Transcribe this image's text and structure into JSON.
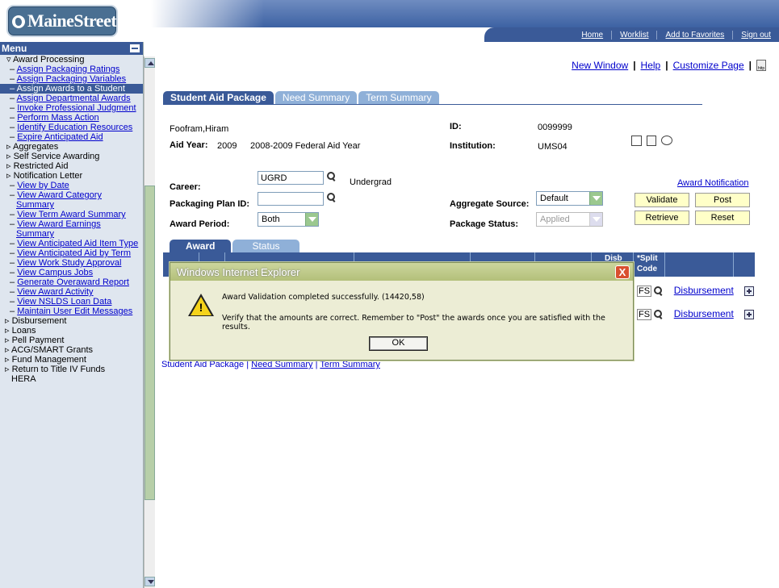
{
  "header": {
    "logo_text": "MaineStreet",
    "nav": [
      "Home",
      "Worklist",
      "Add to Favorites",
      "Sign out"
    ]
  },
  "menu": {
    "title": "Menu",
    "section": "Award Processing",
    "items": [
      {
        "label": "Assign Packaging Ratings"
      },
      {
        "label": "Assign Packaging Variables"
      },
      {
        "label": "Assign Awards to a Student",
        "selected": true
      },
      {
        "label": "Assign Departmental Awards"
      },
      {
        "label": "Invoke Professional Judgment"
      },
      {
        "label": "Perform Mass Action"
      },
      {
        "label": "Identify Education Resources"
      },
      {
        "label": "Expire Anticipated Aid"
      }
    ],
    "subsections": [
      "Aggregates",
      "Self Service Awarding",
      "Restricted Aid",
      "Notification Letter"
    ],
    "inquiry_items": [
      "View by Date",
      "View Award Category Summary",
      "View Term Award Summary",
      "View Award Earnings Summary",
      "View Anticipated Aid Item Type",
      "View Anticipated Aid by Term",
      "View Work Study Approval",
      "View Campus Jobs",
      "Generate Overaward Report",
      "View Award Activity",
      "View NSLDS Loan Data",
      "Maintain User Edit Messages"
    ],
    "top_sections": [
      "Disbursement",
      "Loans",
      "Pell Payment",
      "ACG/SMART Grants",
      "Fund Management",
      "Return to Title IV Funds",
      "HERA"
    ]
  },
  "toplinks": {
    "new_window": "New Window",
    "help": "Help",
    "customize": "Customize Page",
    "http_icon": "http"
  },
  "tabs": [
    "Student Aid Package",
    "Need Summary",
    "Term Summary"
  ],
  "student": {
    "name": "Foofram,Hiram",
    "id_label": "ID:",
    "id": "0099999",
    "aid_year_label": "Aid Year:",
    "aid_year": "2009",
    "aid_year_desc": "2008-2009 Federal Aid Year",
    "institution_label": "Institution:",
    "institution": "UMS04"
  },
  "form": {
    "career_label": "Career:",
    "career": "UGRD",
    "career_desc": "Undergrad",
    "plan_label": "Packaging Plan ID:",
    "plan": "",
    "period_label": "Award Period:",
    "period": "Both",
    "agg_label": "Aggregate Source:",
    "agg": "Default",
    "status_label": "Package Status:",
    "status": "Applied",
    "notif_link": "Award Notification",
    "validate": "Validate",
    "post": "Post",
    "retrieve": "Retrieve",
    "reset": "Reset"
  },
  "grid": {
    "tabs": [
      "Award",
      "Status"
    ],
    "col_disb": "Disb",
    "col_split": "*Split",
    "col_code": "Code",
    "rows": [
      {
        "split": "FS",
        "link": "Disbursement"
      },
      {
        "split": "FS",
        "link": "Disbursement"
      }
    ]
  },
  "bottom_links": [
    "Student Aid Package",
    "Need Summary",
    "Term Summary"
  ],
  "dialog": {
    "title": "Windows Internet Explorer",
    "close": "X",
    "line1": "Award Validation completed successfully. (14420,58)",
    "line2": "Verify that the amounts are correct.  Remember to \"Post\" the awards once you are satisfied with the results.",
    "ok": "OK"
  }
}
